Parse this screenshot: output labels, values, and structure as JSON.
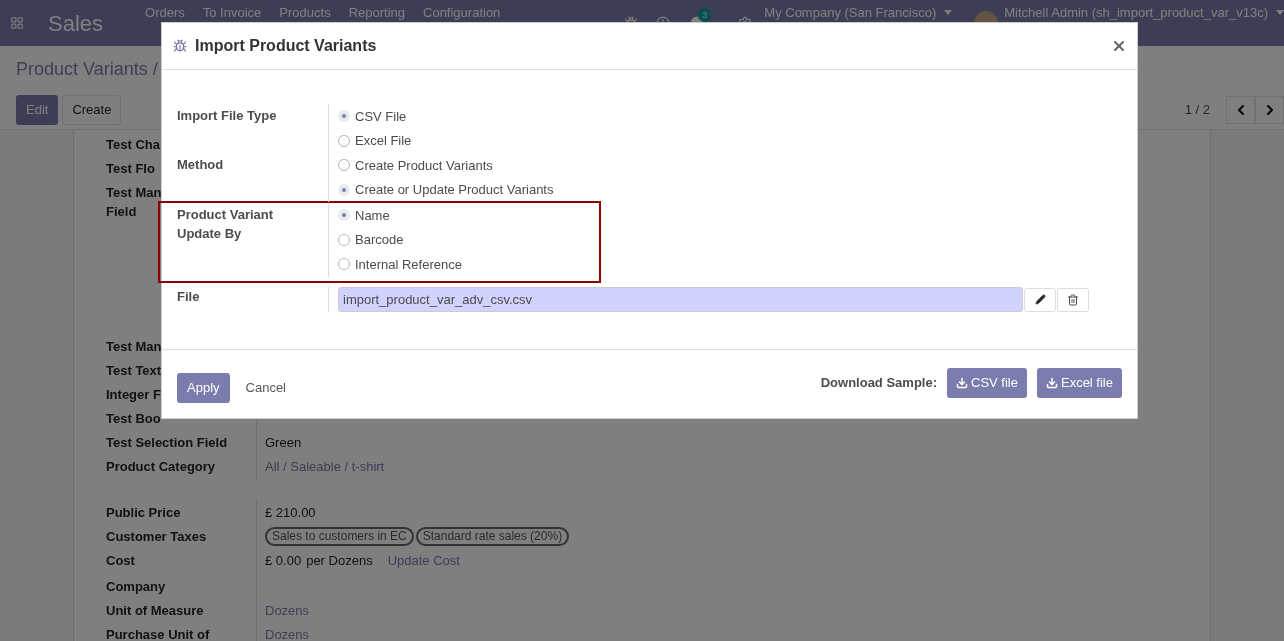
{
  "navbar": {
    "app": "Sales",
    "menu": [
      "Orders",
      "To Invoice",
      "Products",
      "Reporting",
      "Configuration"
    ],
    "messages_count": "3",
    "company": "My Company (San Francisco)",
    "user": "Mitchell Admin (sh_import_product_var_v13c)"
  },
  "control_panel": {
    "breadcrumb": "Product Variants /",
    "buttons": [
      {
        "label": "Edit",
        "kind": "primary"
      },
      {
        "label": "Create",
        "kind": "secondary"
      }
    ],
    "pager": "1 / 2"
  },
  "form": {
    "groups": [
      [
        {
          "kind": "plain",
          "label": "Test Cha"
        },
        {
          "kind": "plain",
          "label": "Test Flo"
        },
        {
          "kind": "tall",
          "label": "Test Man",
          "label_2": "Field"
        },
        {
          "kind": "plain",
          "label": "Test Man"
        },
        {
          "kind": "plain",
          "label": "Test Text"
        },
        {
          "kind": "plain",
          "label": "Integer F"
        },
        {
          "kind": "plain",
          "label": "Test Boo"
        },
        {
          "kind": "text",
          "label": "Test Selection Field",
          "value": "Green"
        },
        {
          "kind": "link",
          "label": "Product Category",
          "value": "All / Saleable / t-shirt"
        }
      ],
      [
        {
          "kind": "text",
          "label": "Public Price",
          "value": "£ 210.00"
        },
        {
          "kind": "tags",
          "label": "Customer Taxes",
          "tags": [
            "Sales to customers in EC",
            "Standard rate sales (20%)"
          ]
        },
        {
          "kind": "cost",
          "label": "Cost",
          "value": "£ 0.00",
          "unit": "per Dozens",
          "action": "Update Cost"
        },
        {
          "kind": "plain",
          "label": "Company"
        },
        {
          "kind": "link",
          "label": "Unit of Measure",
          "value": "Dozens"
        },
        {
          "kind": "link",
          "label": "Purchase Unit of",
          "value": "Dozens"
        }
      ]
    ]
  },
  "dialog": {
    "title": "Import Product Variants",
    "fields": [
      {
        "kind": "radio",
        "label": "Import File Type",
        "highlighted": false,
        "options": [
          {
            "label": "CSV File",
            "selected": true
          },
          {
            "label": "Excel File",
            "selected": false
          }
        ]
      },
      {
        "kind": "radio",
        "label": "Method",
        "highlighted": false,
        "options": [
          {
            "label": "Create Product Variants",
            "selected": false
          },
          {
            "label": "Create or Update Product Variants",
            "selected": true
          }
        ]
      },
      {
        "kind": "radio",
        "label": "Product Variant Update By",
        "highlighted": true,
        "options": [
          {
            "label": "Name",
            "selected": true
          },
          {
            "label": "Barcode",
            "selected": false
          },
          {
            "label": "Internal Reference",
            "selected": false
          }
        ]
      },
      {
        "kind": "file",
        "label": "File",
        "highlighted": false,
        "value": "import_product_var_adv_csv.csv"
      }
    ],
    "footer": {
      "apply": "Apply",
      "cancel": "Cancel",
      "download_label": "Download Sample:",
      "downloads": [
        "CSV file",
        "Excel file"
      ]
    }
  }
}
